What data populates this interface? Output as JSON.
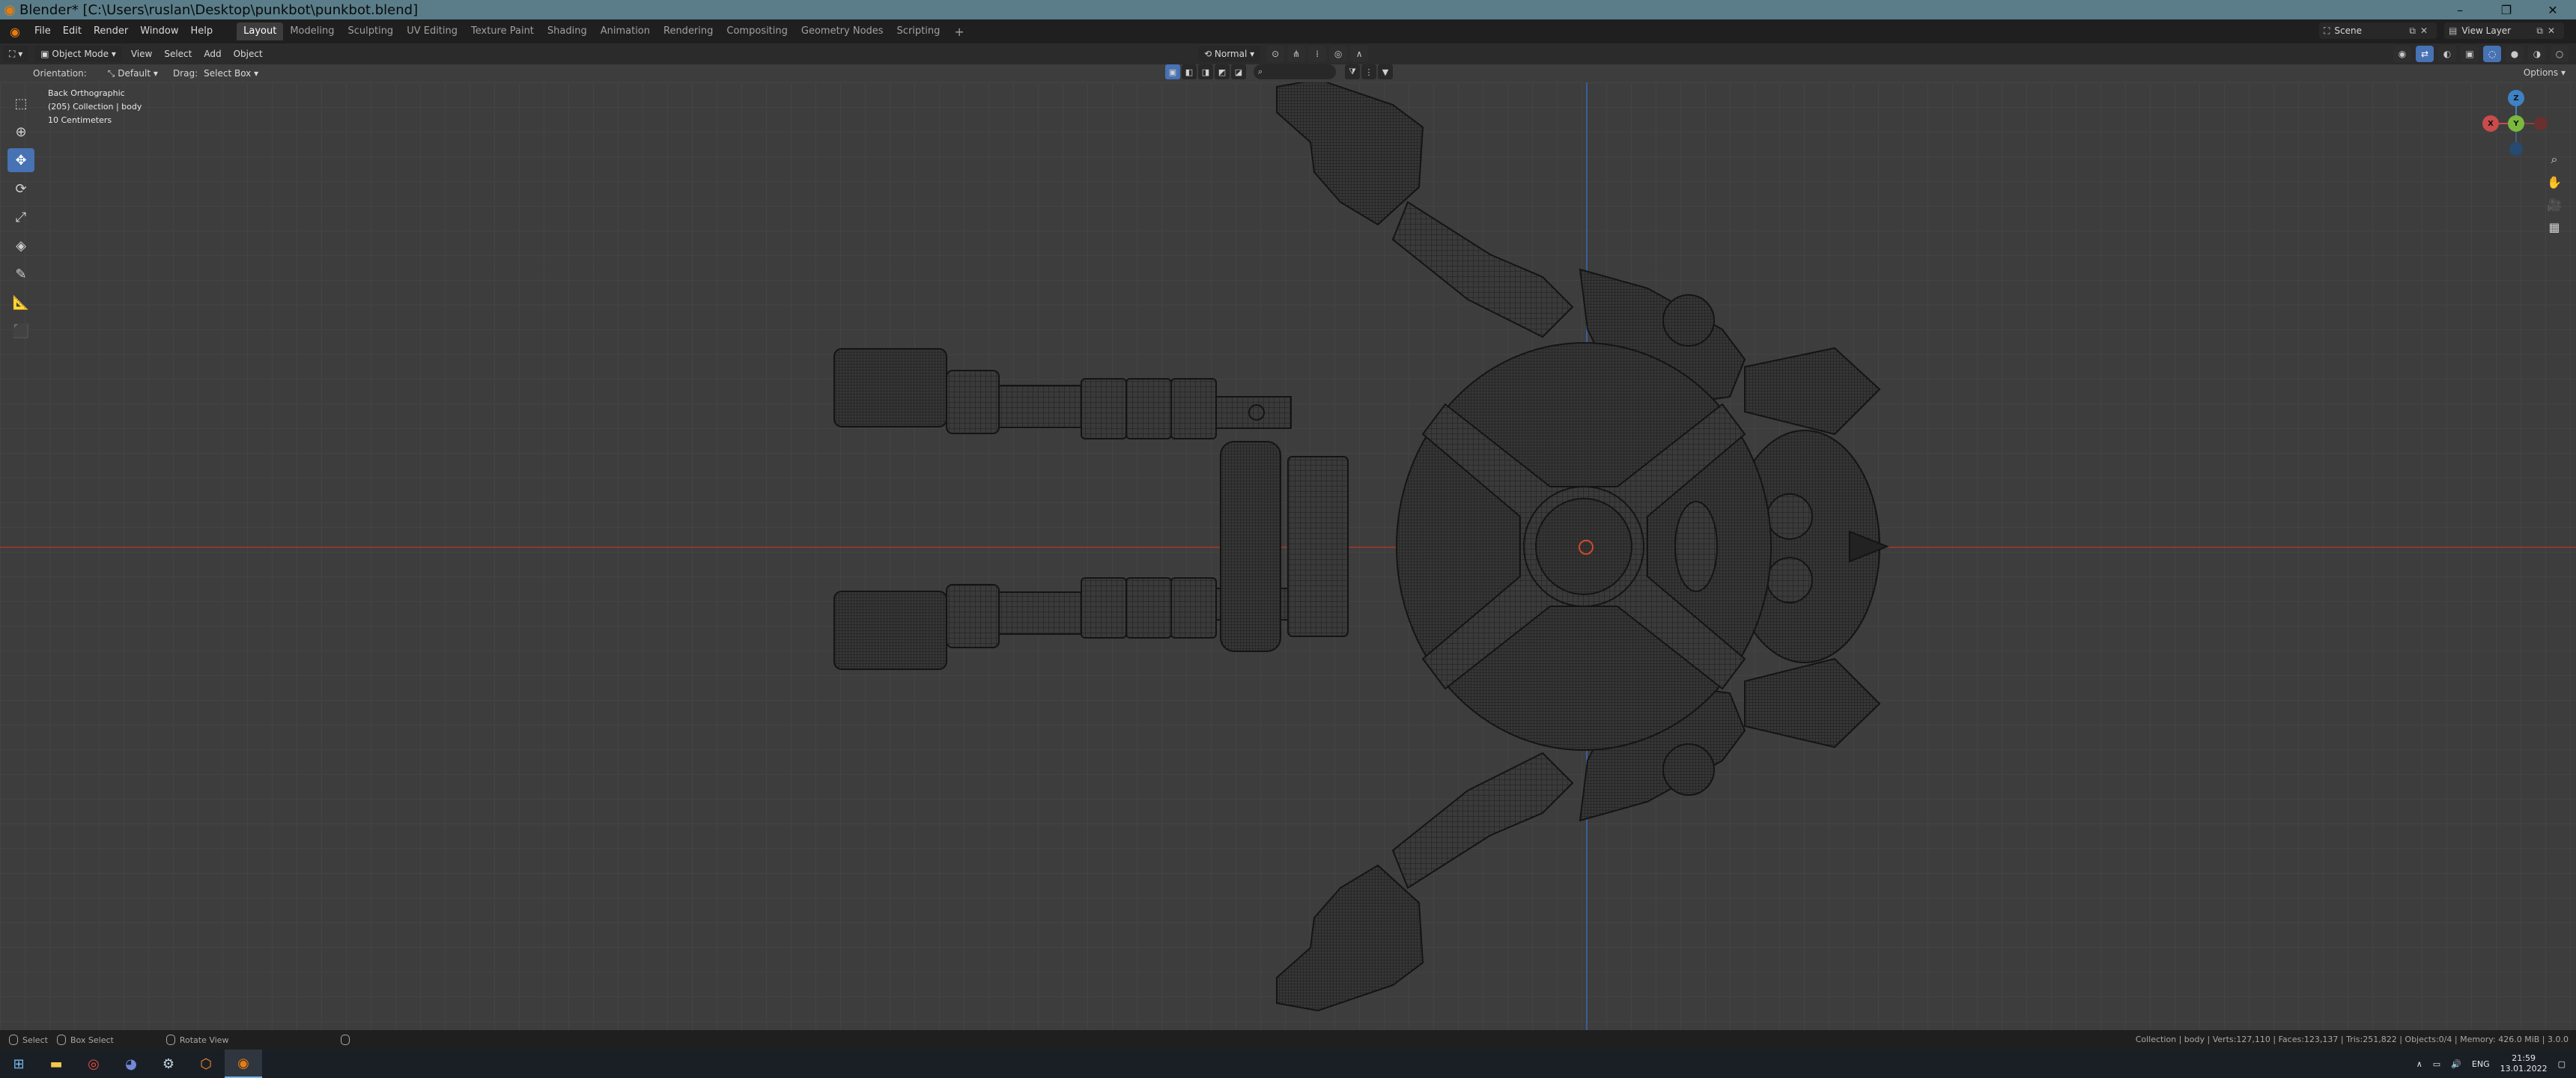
{
  "window": {
    "title": "Blender* [C:\\Users\\ruslan\\Desktop\\punkbot\\punkbot.blend]",
    "controls": [
      "–",
      "❐",
      "✕"
    ],
    "titlebar_color": "#5a7d89"
  },
  "menubar": {
    "menus": [
      "File",
      "Edit",
      "Render",
      "Window",
      "Help"
    ],
    "workspaces": [
      "Layout",
      "Modeling",
      "Sculpting",
      "UV Editing",
      "Texture Paint",
      "Shading",
      "Animation",
      "Rendering",
      "Compositing",
      "Geometry Nodes",
      "Scripting"
    ],
    "active_workspace": "Layout",
    "add_workspace": "+",
    "scene": "Scene",
    "view_layer": "View Layer"
  },
  "header": {
    "mode": "Object Mode",
    "menus": [
      "View",
      "Select",
      "Add",
      "Object"
    ],
    "transform_orientation": "Normal"
  },
  "tool_settings": {
    "orientation_label": "Orientation:",
    "orientation_value": "Default",
    "drag_label": "Drag:",
    "drag_value": "Select Box",
    "options_label": "Options"
  },
  "viewport": {
    "view_name": "Back Orthographic",
    "collection_info": "(205) Collection | body",
    "scale_info": "10 Centimeters",
    "gizmo_axes": {
      "x": "X",
      "y": "Y",
      "z": "Z"
    },
    "colors": {
      "x_axis": "#c94b4b",
      "y_axis": "#7ab83e",
      "z_axis": "#3d82c4",
      "active_tool": "#4772b3"
    }
  },
  "toolbar": {
    "tools": [
      "select-box",
      "cursor",
      "move",
      "rotate",
      "scale",
      "transform",
      "annotate",
      "measure",
      "add-cube"
    ],
    "active_tool": "move"
  },
  "statusbar": {
    "select": "Select",
    "box_select": "Box Select",
    "rotate_view": "Rotate View",
    "stats": "Collection | body | Verts:127,110 | Faces:123,137 | Tris:251,822 | Objects:0/4 | Memory: 426.0 MiB | 3.0.0"
  },
  "taskbar": {
    "apps": [
      "windows-start",
      "file-explorer",
      "chrome",
      "discord",
      "steam",
      "avast",
      "blender"
    ],
    "language": "ENG",
    "time": "21:59",
    "date": "13.01.2022"
  }
}
